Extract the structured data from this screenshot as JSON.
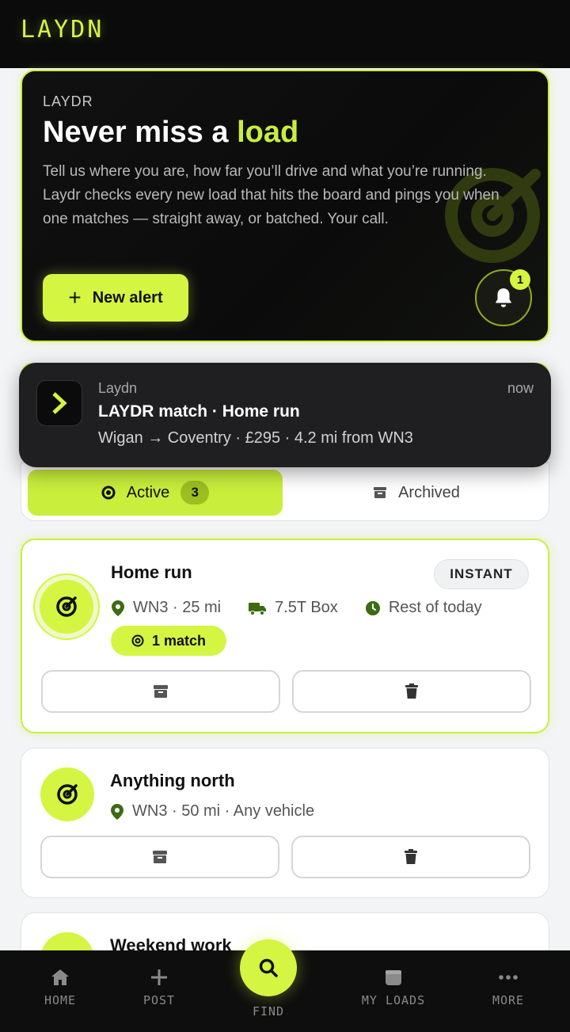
{
  "app": {
    "logo": "LAYDN"
  },
  "hero": {
    "eyebrow": "LAYDR",
    "title_prefix": "Never miss a ",
    "title_highlight": "load",
    "body": "Tell us where you are, how far you’ll drive and what you’re running. Laydr checks every new load that hits the board and pings you when one matches — straight away, or batched. Your call.",
    "new_alert_label": "New alert",
    "bell_badge": "1"
  },
  "notification": {
    "app": "Laydn",
    "time": "now",
    "title": "LAYDR match · Home run",
    "body": "Wigan → Coventry · £295 · 4.2 mi from WN3"
  },
  "tabs": {
    "active_label": "Active",
    "active_count": "3",
    "archived_label": "Archived"
  },
  "alerts": [
    {
      "name": "Home run",
      "mode": "INSTANT",
      "location": "WN3 · 25 mi",
      "vehicle": "7.5T Box",
      "timing": "Rest of today",
      "matches": "1 match"
    },
    {
      "name": "Anything north",
      "location": "WN3 · 50 mi · Any vehicle"
    },
    {
      "name": "Weekend work"
    }
  ],
  "nav": {
    "home": "HOME",
    "post": "POST",
    "find": "FIND",
    "my_loads": "MY LOADS",
    "more": "MORE"
  },
  "colors": {
    "accent": "#d4f542",
    "dark": "#0b0b0b",
    "icon_green": "#3d6b12"
  }
}
